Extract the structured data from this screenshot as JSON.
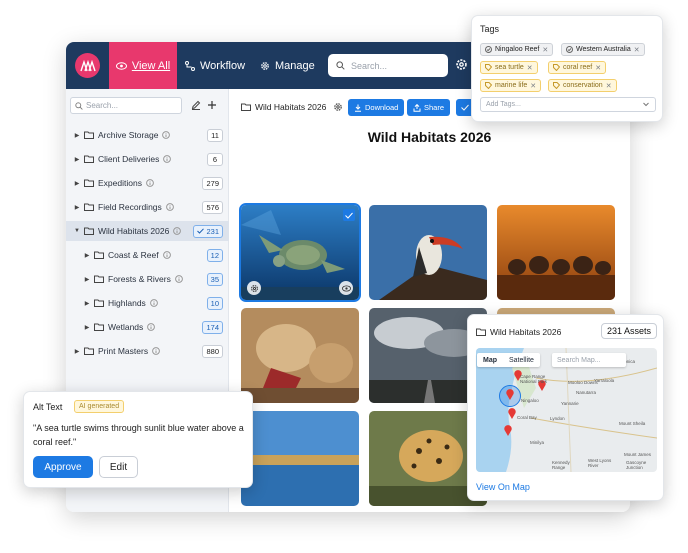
{
  "colors": {
    "nav_bg": "#1e3a5f",
    "brand_pink": "#e8386d",
    "accent_blue": "#1d7ae3",
    "ai_yellow": "#f3cf6d"
  },
  "topbar": {
    "nav": [
      {
        "label": "View All",
        "icon": "eye-icon"
      },
      {
        "label": "Workflow",
        "icon": "workflow-icon"
      },
      {
        "label": "Manage",
        "icon": "gear-icon"
      }
    ],
    "search_placeholder": "Search..."
  },
  "sidebar": {
    "search_placeholder": "Search...",
    "tree": [
      {
        "label": "Archive Storage",
        "count": "11"
      },
      {
        "label": "Client Deliveries",
        "count": "6"
      },
      {
        "label": "Expeditions",
        "count": "279"
      },
      {
        "label": "Field Recordings",
        "count": "576"
      },
      {
        "label": "Wild Habitats 2026",
        "count": "231",
        "selected": true
      },
      {
        "label": "Coast & Reef",
        "count": "12"
      },
      {
        "label": "Forests & Rivers",
        "count": "35"
      },
      {
        "label": "Highlands",
        "count": "10"
      },
      {
        "label": "Wetlands",
        "count": "174"
      },
      {
        "label": "Print Masters",
        "count": "880"
      }
    ]
  },
  "main": {
    "breadcrumb": "Wild Habitats 2026",
    "download_label": "Download",
    "share_label": "Share",
    "title": "Wild Habitats 2026"
  },
  "tags": {
    "title": "Tags",
    "items": [
      {
        "label": "Ningaloo Reef",
        "style": "gray",
        "icon": "verified-icon"
      },
      {
        "label": "Western Australia",
        "style": "gray",
        "icon": "verified-icon"
      },
      {
        "label": "sea turtle",
        "style": "yellow",
        "icon": "ai-tag-icon"
      },
      {
        "label": "coral reef",
        "style": "yellow",
        "icon": "ai-tag-icon"
      },
      {
        "label": "marine life",
        "style": "yellow",
        "icon": "ai-tag-icon"
      },
      {
        "label": "conservation",
        "style": "yellow",
        "icon": "ai-tag-icon"
      }
    ],
    "add_placeholder": "Add Tags..."
  },
  "map_card": {
    "folder": "Wild Habitats 2026",
    "assets": "231 Assets",
    "tab_map": "Map",
    "tab_satellite": "Satellite",
    "search_placeholder": "Search Map...",
    "link": "View On Map",
    "places": {
      "cape_range": "Cape Range\nNational Park",
      "ningaloo": "Ningaloo",
      "coral_bay": "Coral Bay",
      "lyndon": "Lyndon",
      "minilya": "Minilya",
      "nanutarra": "Nanutarra",
      "yarraloola": "Yarraloola",
      "pannawonica": "Pannawonica",
      "yannarie": "Yannarie",
      "mount_sheila": "Mount Sheila",
      "kennedy_range": "Kennedy\nRange",
      "west_lyons": "West Lyons\nRiver",
      "mount_james": "Mount James",
      "gascoyne": "Gascoyne\nJunction",
      "mooloo": "Mooloo Downs"
    }
  },
  "alt_text": {
    "title": "Alt Text",
    "badge": "AI generated",
    "text": "\"A sea turtle swims through sunlit blue water above a coral reef.\"",
    "approve": "Approve",
    "edit": "Edit"
  }
}
